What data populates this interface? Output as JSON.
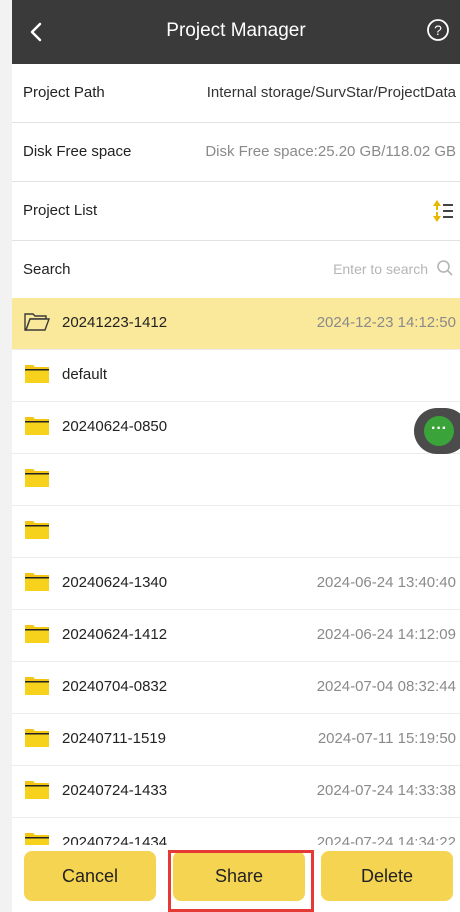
{
  "header": {
    "title": "Project Manager"
  },
  "info": {
    "project_path_label": "Project Path",
    "project_path_value": "Internal storage/SurvStar/ProjectData",
    "disk_label": "Disk Free space",
    "disk_value": "Disk Free space:25.20 GB/118.02 GB",
    "list_label": "Project List",
    "search_label": "Search",
    "search_placeholder": "Enter to search"
  },
  "projects": [
    {
      "name": "20241223-1412",
      "date": "2024-12-23 14:12:50",
      "selected": true
    },
    {
      "name": "default",
      "date": ""
    },
    {
      "name": "20240624-0850",
      "date": ""
    },
    {
      "name": "",
      "date": ""
    },
    {
      "name": "",
      "date": ""
    },
    {
      "name": "20240624-1340",
      "date": "2024-06-24 13:40:40"
    },
    {
      "name": "20240624-1412",
      "date": "2024-06-24 14:12:09"
    },
    {
      "name": "20240704-0832",
      "date": "2024-07-04 08:32:44"
    },
    {
      "name": "20240711-1519",
      "date": "2024-07-11 15:19:50"
    },
    {
      "name": "20240724-1433",
      "date": "2024-07-24 14:33:38"
    },
    {
      "name": "20240724-1434",
      "date": "2024-07-24 14:34:22"
    }
  ],
  "float_button": {
    "label": "···"
  },
  "buttons": {
    "cancel": "Cancel",
    "share": "Share",
    "delete": "Delete"
  },
  "colors": {
    "accent": "#f5d451",
    "selected_row": "#fbe99b",
    "header": "#3a3a3a",
    "highlight": "#e53935",
    "float_green": "#3aa33a"
  }
}
